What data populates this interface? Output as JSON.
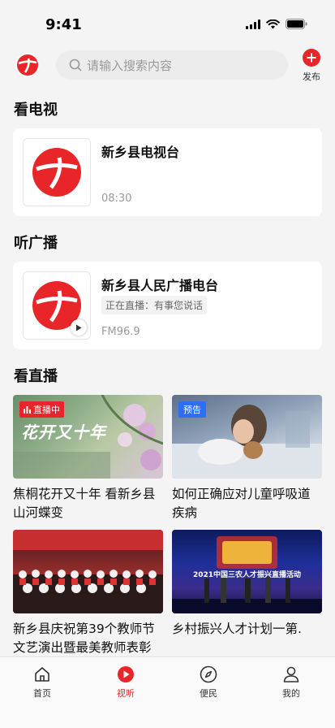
{
  "status": {
    "time": "9:41"
  },
  "search": {
    "placeholder": "请输入搜索内容"
  },
  "publish": {
    "label": "发布"
  },
  "sections": {
    "tv": "看电视",
    "radio": "听广播",
    "live": "看直播"
  },
  "tv_card": {
    "name": "新乡县电视台",
    "time": "08:30"
  },
  "radio_card": {
    "name": "新乡县人民广播电台",
    "now_playing": "正在直播：有事您说话",
    "frequency": "FM96.9"
  },
  "live_items": [
    {
      "badge": "直播中",
      "title": "焦桐花开又十年 看新乡县山河蝶变",
      "poster_text": "花开又十年"
    },
    {
      "badge": "预告",
      "title": "如何正确应对儿童呼吸道疾病"
    },
    {
      "title": "新乡县庆祝第39个教师节文艺演出暨最美教师表彰"
    },
    {
      "title": "乡村振兴人才计划一第.",
      "poster_text": "2021中国三农人才振兴直播活动"
    }
  ],
  "tabs": [
    {
      "label": "首页",
      "icon": "home-icon"
    },
    {
      "label": "视听",
      "icon": "play-circle-icon",
      "active": true
    },
    {
      "label": "便民",
      "icon": "compass-icon"
    },
    {
      "label": "我的",
      "icon": "user-icon"
    }
  ],
  "colors": {
    "accent": "#e8262a",
    "preview_badge": "#2f6df6"
  }
}
